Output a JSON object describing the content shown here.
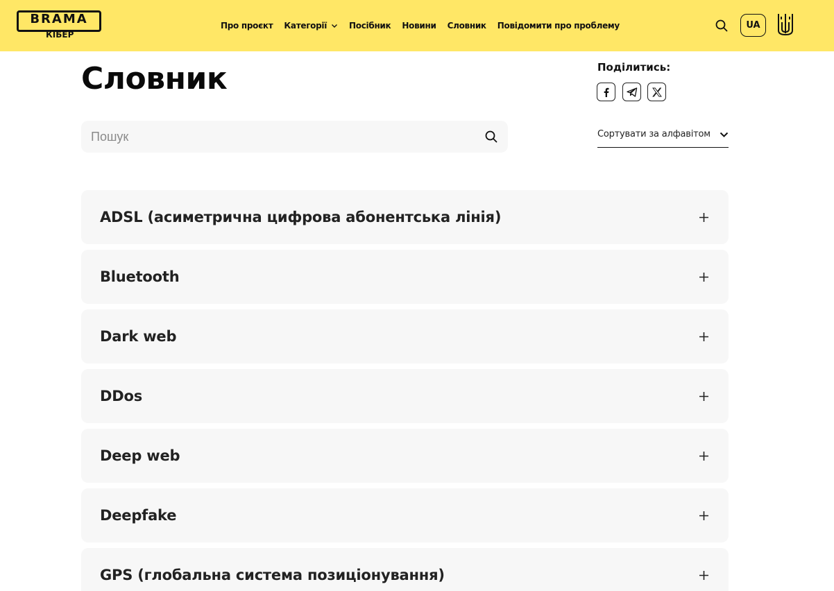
{
  "header": {
    "logo_word": "BRAMA",
    "logo_sub": "КІБЕР",
    "nav": [
      {
        "label": "Про проєкт"
      },
      {
        "label": "Категорії"
      },
      {
        "label": "Посібник"
      },
      {
        "label": "Новини"
      },
      {
        "label": "Словник"
      },
      {
        "label": "Повідомити про проблему"
      }
    ],
    "lang": "UA",
    "search_icon": "search-icon",
    "emblem_icon": "trident-icon"
  },
  "page": {
    "title": "Словник",
    "share_label": "Поділитись:",
    "share_icons": [
      "facebook-icon",
      "telegram-icon",
      "x-icon"
    ]
  },
  "search": {
    "placeholder": "Пошук",
    "value": ""
  },
  "sort": {
    "label": "Сортувати за алфавітом"
  },
  "glossary": [
    {
      "term": "ADSL (асиметрична цифрова абонентська лінія)"
    },
    {
      "term": "Bluetooth"
    },
    {
      "term": "Dark web"
    },
    {
      "term": "DDos"
    },
    {
      "term": "Deep web"
    },
    {
      "term": "Deepfake"
    },
    {
      "term": "GPS (глобальна система позиціонування)"
    }
  ],
  "colors": {
    "header_bg": "#ffe766",
    "item_bg": "#f7f7f7",
    "text": "#111111"
  }
}
